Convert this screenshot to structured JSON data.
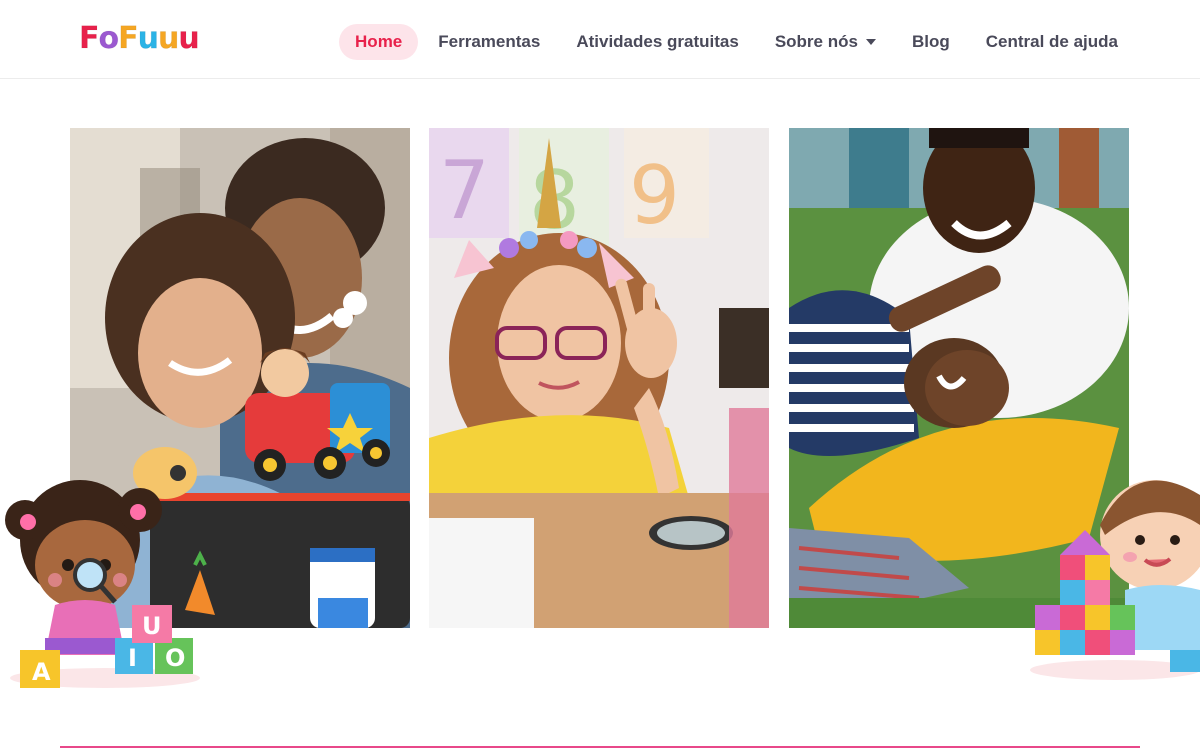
{
  "brand": {
    "logo_letters": [
      "F",
      "o",
      "F",
      "u",
      "u",
      "u"
    ],
    "logo_colors": [
      "#e8214b",
      "#9b59d0",
      "#f5a623",
      "#2bb3e6",
      "#f5a623",
      "#e8214b"
    ]
  },
  "nav": {
    "items": [
      {
        "label": "Home",
        "active": true
      },
      {
        "label": "Ferramentas",
        "active": false
      },
      {
        "label": "Atividades gratuitas",
        "active": false
      },
      {
        "label": "Sobre nós",
        "active": false,
        "dropdown": true
      },
      {
        "label": "Blog",
        "active": false
      },
      {
        "label": "Central de ajuda",
        "active": false
      }
    ]
  },
  "colors": {
    "accent": "#e8214b",
    "nav_active_bg": "#fde4ea",
    "nav_text": "#4a4a5a",
    "divider": "#e8488a"
  },
  "blocks": {
    "left": [
      "A",
      "U",
      "I",
      "O"
    ]
  }
}
